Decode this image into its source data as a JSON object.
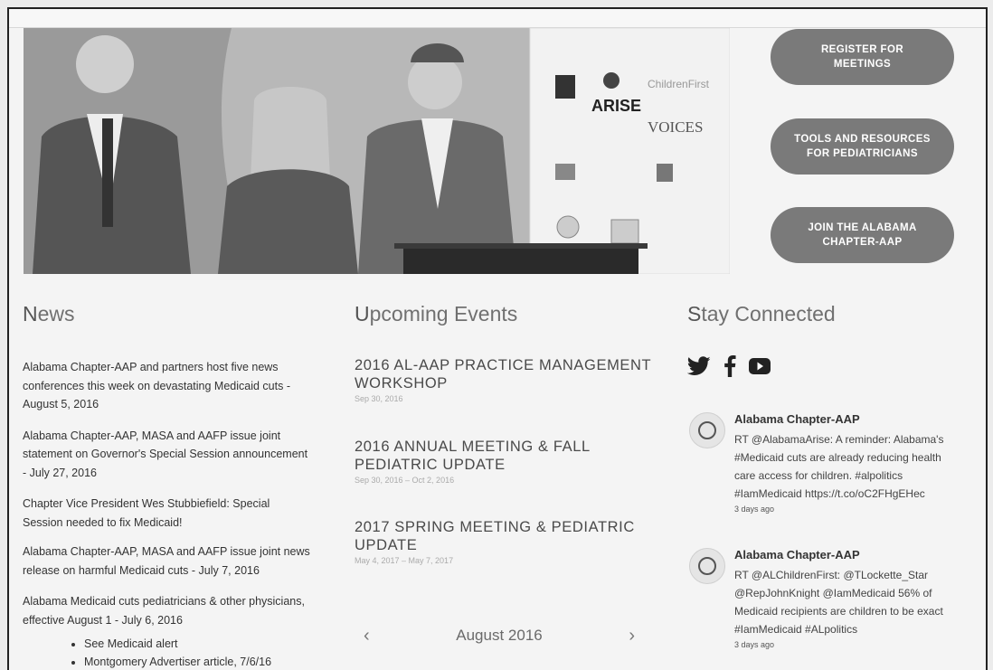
{
  "buttons": {
    "register": "REGISTER FOR\nMEETINGS",
    "tools": "TOOLS AND RESOURCES\nFOR PEDIATRICIANS",
    "join": "JOIN THE ALABAMA\nCHAPTER-AAP"
  },
  "hero": {
    "sponsor_1": "ARISE",
    "sponsor_2": "ChildrenFirst",
    "sponsor_3": "VOICES"
  },
  "headings": {
    "news": {
      "cap": "N",
      "rest": "ews"
    },
    "events": {
      "cap": "U",
      "rest": "pcoming Events"
    },
    "connected": {
      "cap": "S",
      "rest": "tay Connected"
    }
  },
  "news": [
    "Alabama Chapter-AAP and partners host five news conferences this week on devastating Medicaid cuts - August 5, 2016",
    "Alabama Chapter-AAP, MASA and AAFP issue joint statement on Governor's Special Session announcement - July 27, 2016",
    "Chapter Vice President Wes Stubbiefield:  Special Session needed to fix Medicaid!",
    "Alabama Chapter-AAP, MASA and AAFP issue joint news release on harmful Medicaid cuts - July 7, 2016",
    "Alabama Medicaid cuts pediatricians & other physicians, effective August 1 - July 6, 2016"
  ],
  "news_sublinks": [
    "See Medicaid alert",
    "Montgomery Advertiser article, 7/6/16"
  ],
  "events": [
    {
      "title": "2016 AL-AAP PRACTICE MANAGEMENT WORKSHOP",
      "date": "Sep 30, 2016"
    },
    {
      "title": "2016 ANNUAL MEETING & FALL PEDIATRIC UPDATE",
      "date": "Sep 30, 2016 – Oct 2, 2016"
    },
    {
      "title": "2017 SPRING MEETING & PEDIATRIC UPDATE",
      "date": "May 4, 2017 – May 7, 2017"
    }
  ],
  "calendar": {
    "prev": "‹",
    "month": "August 2016",
    "next": "›"
  },
  "social_icons": [
    "twitter-icon",
    "facebook-icon",
    "youtube-icon"
  ],
  "tweets": [
    {
      "author": "Alabama Chapter-AAP",
      "text": "RT @AlabamaArise: A reminder: Alabama's #Medicaid cuts are already reducing health care access for children. #alpolitics #IamMedicaid https://t.co/oC2FHgEHec",
      "ago": "3 days ago"
    },
    {
      "author": "Alabama Chapter-AAP",
      "text": "RT @ALChildrenFirst: @TLockette_Star @RepJohnKnight @IamMedicaid 56% of Medicaid recipients are children to be exact #IamMedicaid #ALpolitics",
      "ago": "3 days ago"
    }
  ]
}
